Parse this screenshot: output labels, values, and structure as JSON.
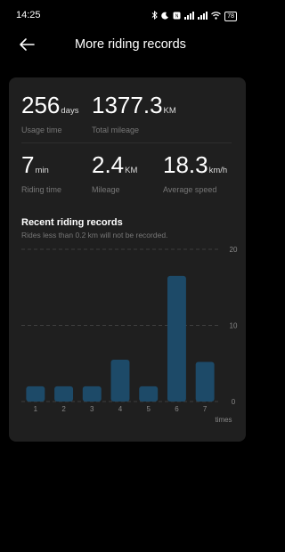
{
  "status": {
    "time": "14:25",
    "icons": [
      "bluetooth-icon",
      "moon-icon",
      "nfc-icon",
      "signal-icon",
      "signal-icon",
      "wifi-icon"
    ],
    "battery": "78"
  },
  "header": {
    "title": "More riding records",
    "back_icon": "back-arrow-icon"
  },
  "stats": {
    "usage_time": {
      "value": "256",
      "unit": "days",
      "label": "Usage time"
    },
    "total_mileage": {
      "value": "1377.3",
      "unit": "KM",
      "label": "Total mileage"
    },
    "riding_time": {
      "value": "7",
      "unit": "min",
      "label": "Riding time"
    },
    "mileage": {
      "value": "2.4",
      "unit": "KM",
      "label": "Mileage"
    },
    "average_speed": {
      "value": "18.3",
      "unit": "km/h",
      "label": "Average speed"
    }
  },
  "recent": {
    "title": "Recent riding records",
    "subtitle": "Rides less than 0.2 km will not be recorded."
  },
  "colors": {
    "bar": "#1d4a68",
    "background": "#000000",
    "card": "#1f1f1f"
  },
  "chart_data": {
    "type": "bar",
    "categories": [
      "1",
      "2",
      "3",
      "4",
      "5",
      "6",
      "7"
    ],
    "values": [
      2,
      2,
      2,
      5.5,
      2,
      16.5,
      5.2
    ],
    "xlabel": "times",
    "ylabel": "",
    "ylim": [
      0,
      20
    ],
    "yticks": [
      "0",
      "10",
      "20"
    ],
    "grid": true
  }
}
